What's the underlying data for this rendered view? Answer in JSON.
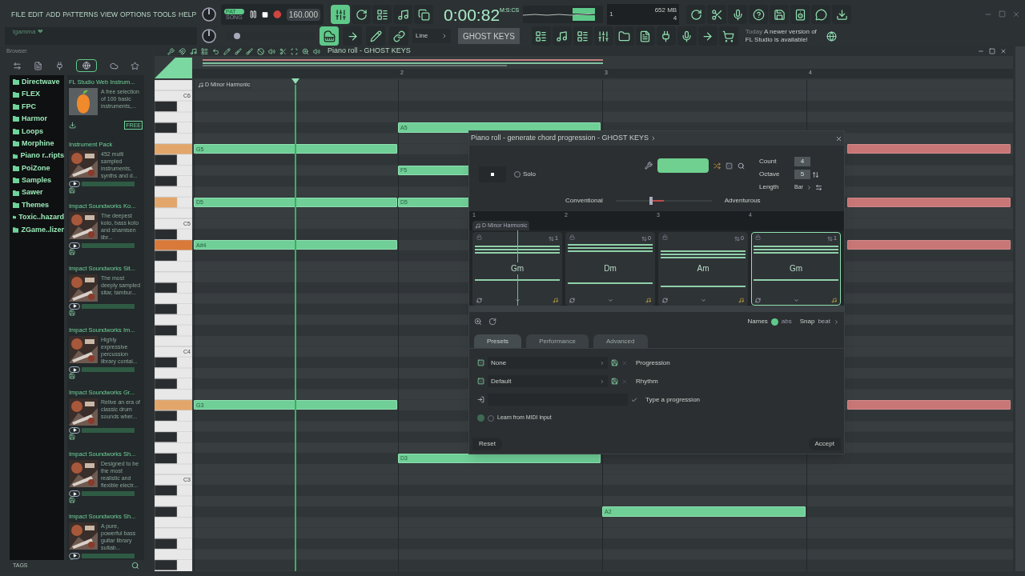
{
  "menu": [
    "FILE",
    "EDIT",
    "ADD",
    "PATTERNS",
    "VIEW",
    "OPTIONS",
    "TOOLS",
    "HELP"
  ],
  "hint_bar": {
    "text": "lgamma ❤"
  },
  "pitch_slider": {
    "level": 0.1
  },
  "transport": {
    "pat_label": "PAT",
    "song_label": "SONG",
    "song_mode": false,
    "tempo": "160.000",
    "time": "0:00:82",
    "time_unit": "M:S:CS"
  },
  "cpu": {
    "voices": "1",
    "memory": "652 MB",
    "polyphony": "4"
  },
  "snap": {
    "value": "Line"
  },
  "pattern": {
    "name": "GHOST KEYS"
  },
  "news": {
    "date": "Today",
    "text": "A newer version of FL Studio is available!"
  },
  "browser": {
    "title": "Browser",
    "folders": [
      "Directwave",
      "FLEX",
      "FPC",
      "Harmor",
      "Loops",
      "Morphine",
      "Piano r..ripts",
      "PoiZone",
      "Samples",
      "Sawer",
      "Themes",
      "Toxic..hazard",
      "ZGame..lizer"
    ],
    "items": [
      {
        "title": "FL Studio Web Instrum...",
        "description": "A free selection of 100 basic instruments,...",
        "kind": "logo",
        "badge": "FREE"
      },
      {
        "title": "Instrument Pack",
        "description": "452 multi sampled instruments, synths and d...",
        "kind": "picture"
      },
      {
        "title": "Impact Soundworks Ko...",
        "description": "The deepest koto, bass koto and shamisen libr...",
        "kind": "picture"
      },
      {
        "title": "Impact Soundworks Sit...",
        "description": "The most deeply sampled sitar, tambur...",
        "kind": "picture"
      },
      {
        "title": "Impact Soundworks Im...",
        "description": "Highly expressive percussion library contai...",
        "kind": "picture"
      },
      {
        "title": "Impact Soundworks Gr...",
        "description": "Relive an era of classic drum sounds wher...",
        "kind": "picture"
      },
      {
        "title": "Impact Soundworks Sh...",
        "description": "Designed to be the most realistic and flexible electr...",
        "kind": "picture"
      },
      {
        "title": "Impact Soundworks Sh...",
        "description": "A pure, powerful bass guitar library suitab...",
        "kind": "picture"
      }
    ],
    "tags_label": "TAGS"
  },
  "piano_roll": {
    "title": "Piano roll - GHOST KEYS",
    "scale": "D Minor Harmonic",
    "bars": [
      "2",
      "3",
      "4"
    ],
    "octaves": [
      "C6",
      "C5",
      "C4",
      "C3"
    ],
    "notes": [
      {
        "label": "G5",
        "ghost": false
      },
      {
        "label": "D5",
        "ghost": false
      },
      {
        "label": "A#4",
        "ghost": false
      },
      {
        "label": "G3",
        "ghost": false
      },
      {
        "label": "A5",
        "ghost": false
      },
      {
        "label": "F5",
        "ghost": false
      },
      {
        "label": "D5",
        "ghost": false
      },
      {
        "label": "D3",
        "ghost": false
      },
      {
        "label": "A2",
        "ghost": false
      },
      {
        "ghost": true
      },
      {
        "ghost": true
      },
      {
        "ghost": true
      },
      {
        "ghost": true
      }
    ]
  },
  "dialog": {
    "title": "Piano roll - generate chord progression - GHOST KEYS",
    "solo": {
      "label": "Solo",
      "on": false
    },
    "count": {
      "label": "Count",
      "value": "4"
    },
    "octave": {
      "label": "Octave",
      "value": "5"
    },
    "length": {
      "label": "Length",
      "value": "Bar"
    },
    "slider": {
      "left": "Conventional",
      "right": "Adventurous",
      "level": 0.35
    },
    "bars": [
      "1",
      "2",
      "3",
      "4"
    ],
    "scale": "D Minor Harmonic",
    "chords": [
      {
        "name": "Gm",
        "inversion": "1",
        "selected": false
      },
      {
        "name": "Dm",
        "inversion": "0",
        "selected": false
      },
      {
        "name": "Am",
        "inversion": "0",
        "selected": false
      },
      {
        "name": "Gm",
        "inversion": "1",
        "selected": true
      }
    ],
    "names": {
      "label": "Names",
      "on": true,
      "value": "abs"
    },
    "snap": {
      "label": "Snap",
      "value": "beat"
    },
    "tabs": [
      {
        "label": "Presets",
        "selected": true
      },
      {
        "label": "Performance",
        "selected": false
      },
      {
        "label": "Advanced",
        "selected": false
      }
    ],
    "presets": [
      {
        "value": "None",
        "label": "Progression"
      },
      {
        "value": "Default",
        "label": "Rhythm"
      }
    ],
    "type_field": {
      "label": "Type a progression"
    },
    "midi": {
      "label": "Learn from MIDI input",
      "on": false
    },
    "reset": "Reset",
    "accept": "Accept"
  }
}
